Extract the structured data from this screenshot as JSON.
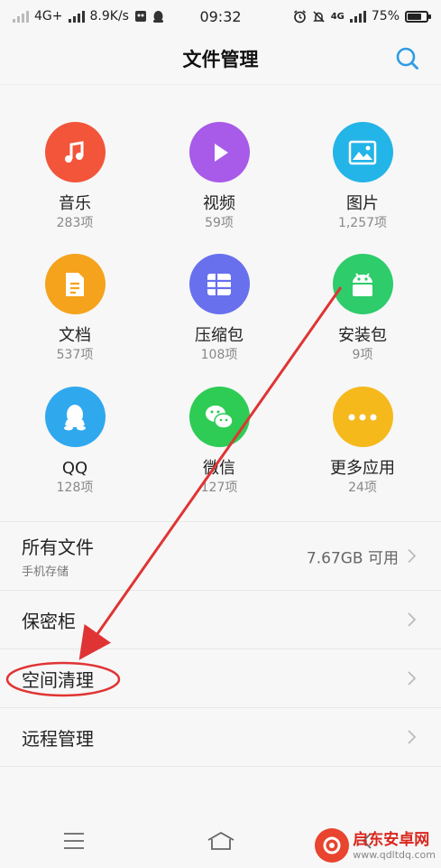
{
  "status_bar": {
    "network": "4G+",
    "speed": "8.9K/s",
    "time": "09:32",
    "net2": "4G",
    "battery": "75%",
    "battery_level": 0.75
  },
  "header": {
    "title": "文件管理"
  },
  "categories": [
    {
      "name": "音乐",
      "count": "283项",
      "color": "#f2553a",
      "icon": "music-icon"
    },
    {
      "name": "视频",
      "count": "59项",
      "color": "#a85ae8",
      "icon": "play-icon"
    },
    {
      "name": "图片",
      "count": "1,257项",
      "color": "#23b4e8",
      "icon": "image-icon"
    },
    {
      "name": "文档",
      "count": "537项",
      "color": "#f5a21c",
      "icon": "document-icon"
    },
    {
      "name": "压缩包",
      "count": "108项",
      "color": "#6870ee",
      "icon": "archive-icon"
    },
    {
      "name": "安装包",
      "count": "9项",
      "color": "#2ecc6a",
      "icon": "android-icon"
    },
    {
      "name": "QQ",
      "count": "128项",
      "color": "#2fa8ee",
      "icon": "qq-icon"
    },
    {
      "name": "微信",
      "count": "127项",
      "color": "#2ecc55",
      "icon": "wechat-icon"
    },
    {
      "name": "更多应用",
      "count": "24项",
      "color": "#f5b91c",
      "icon": "more-icon"
    }
  ],
  "list": {
    "all_files": {
      "label": "所有文件",
      "sub": "手机存储",
      "value": "7.67GB 可用"
    },
    "vault": {
      "label": "保密柜"
    },
    "cleanup": {
      "label": "空间清理"
    },
    "remote": {
      "label": "远程管理"
    }
  },
  "nav": {
    "menu_icon": "menu-icon",
    "home_icon": "home-icon"
  },
  "watermark": {
    "cn": "启东安卓网",
    "url": "www.qdltdq.com"
  },
  "annotation_color": "#e03434"
}
